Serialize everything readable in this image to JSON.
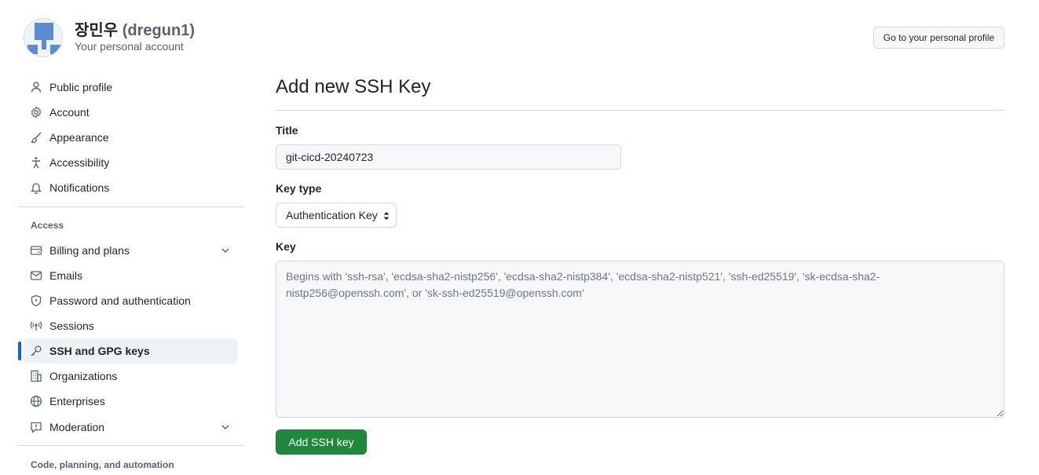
{
  "header": {
    "display_name": "장민우",
    "login": "(dregun1)",
    "subtitle": "Your personal account",
    "profile_button": "Go to your personal profile"
  },
  "sidebar": {
    "items": [
      {
        "label": "Public profile",
        "icon": "person-icon"
      },
      {
        "label": "Account",
        "icon": "gear-icon"
      },
      {
        "label": "Appearance",
        "icon": "paintbrush-icon"
      },
      {
        "label": "Accessibility",
        "icon": "accessibility-icon"
      },
      {
        "label": "Notifications",
        "icon": "bell-icon"
      }
    ],
    "access_heading": "Access",
    "access_items": [
      {
        "label": "Billing and plans",
        "icon": "credit-card-icon",
        "expandable": true
      },
      {
        "label": "Emails",
        "icon": "mail-icon"
      },
      {
        "label": "Password and authentication",
        "icon": "shield-lock-icon"
      },
      {
        "label": "Sessions",
        "icon": "broadcast-icon"
      },
      {
        "label": "SSH and GPG keys",
        "icon": "key-icon",
        "active": true
      },
      {
        "label": "Organizations",
        "icon": "organization-icon"
      },
      {
        "label": "Enterprises",
        "icon": "globe-icon"
      },
      {
        "label": "Moderation",
        "icon": "report-icon",
        "expandable": true
      }
    ],
    "code_heading": "Code, planning, and automation"
  },
  "main": {
    "title": "Add new SSH Key",
    "title_label": "Title",
    "title_value": "git-cicd-20240723",
    "key_type_label": "Key type",
    "key_type_value": "Authentication Key",
    "key_label": "Key",
    "key_placeholder": "Begins with 'ssh-rsa', 'ecdsa-sha2-nistp256', 'ecdsa-sha2-nistp384', 'ecdsa-sha2-nistp521', 'ssh-ed25519', 'sk-ecdsa-sha2-nistp256@openssh.com', or 'sk-ssh-ed25519@openssh.com'",
    "submit_label": "Add SSH key"
  },
  "colors": {
    "primary_button": "#1f883d",
    "active_indicator": "#0969da",
    "avatar_blue": "#5b8bd0"
  }
}
